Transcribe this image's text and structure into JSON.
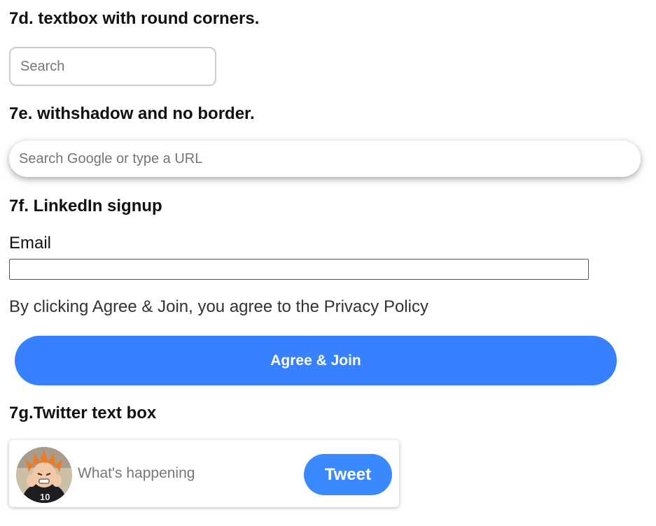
{
  "sections": {
    "s7d": {
      "number": "7d.",
      "title": " textbox with round corners."
    },
    "s7e": {
      "number": "7e.",
      "title": " withshadow and no border."
    },
    "s7f": {
      "number": "7f.",
      "title": " LinkedIn signup"
    },
    "s7g": {
      "number": "7g.",
      "title": "Twitter text box"
    }
  },
  "round_search": {
    "placeholder": "Search",
    "value": ""
  },
  "shadow_search": {
    "placeholder": "Search Google or type a URL",
    "value": ""
  },
  "linkedin": {
    "email_label": "Email",
    "email_value": "",
    "agree_text": "By clicking Agree & Join, you agree to the Privacy Policy",
    "agree_button": "Agree & Join"
  },
  "twitter": {
    "placeholder": "What's happening",
    "tweet_button": "Tweet",
    "avatar_icon": "user-avatar-image"
  },
  "colors": {
    "primary_blue": "#3780ff",
    "tweet_blue": "#3a89ff",
    "input_border": "#cccccc"
  }
}
